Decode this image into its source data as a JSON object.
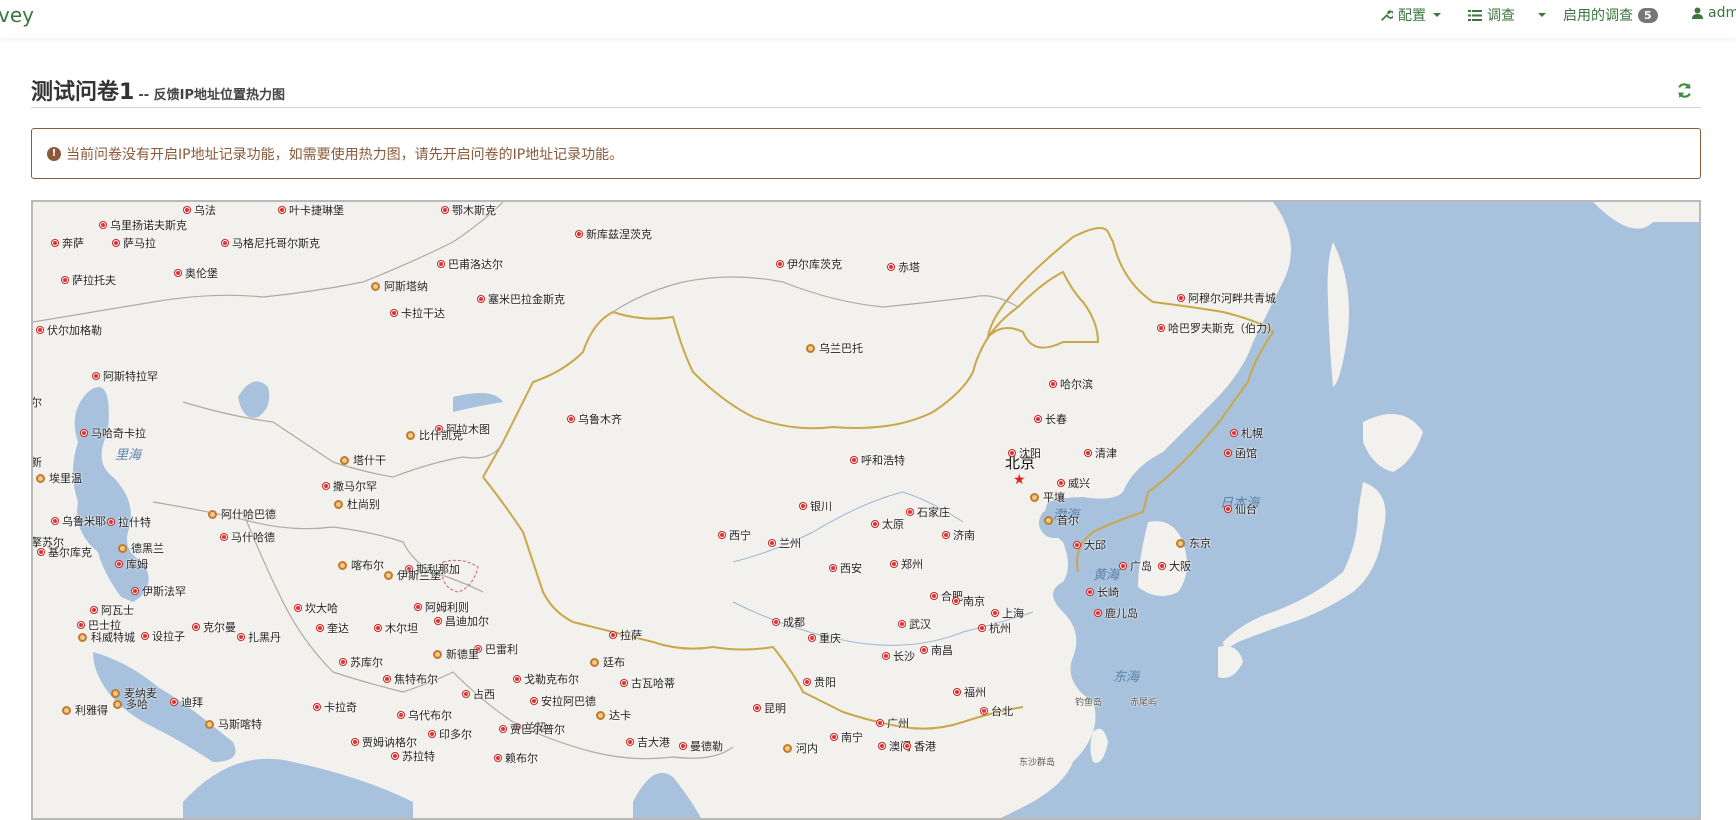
{
  "brand": "vey",
  "nav": {
    "config": "配置",
    "survey": "调查",
    "enabled_surveys": "启用的调查",
    "enabled_count": "5",
    "user": "admi"
  },
  "header": {
    "title": "测试问卷1",
    "subtitle": "-- 反馈IP地址位置热力图"
  },
  "alert": {
    "message": "当前问卷没有开启IP地址记录功能，如需要使用热力图，请先开启问卷的IP地址记录功能。"
  },
  "map": {
    "colors": {
      "land": "#f3f1ed",
      "water": "#a8c1dc",
      "border": "#c8a84a",
      "minor_border": "#b0aaa0"
    },
    "capital": "北京",
    "seas": [
      "里海",
      "渤海",
      "黄海",
      "东海",
      "日本海"
    ],
    "islands": [
      "钓鱼岛",
      "赤尾屿",
      "东沙群岛"
    ],
    "cities": [
      {
        "name": "乌法",
        "kind": "dot"
      },
      {
        "name": "叶卡捷琳堡",
        "kind": "dot"
      },
      {
        "name": "鄂木斯克",
        "kind": "dot"
      },
      {
        "name": "乌里扬诺夫斯克",
        "kind": "dot"
      },
      {
        "name": "奔萨",
        "kind": "dot"
      },
      {
        "name": "萨马拉",
        "kind": "dot"
      },
      {
        "name": "马格尼托哥尔斯克",
        "kind": "dot"
      },
      {
        "name": "新库兹涅茨克",
        "kind": "dot"
      },
      {
        "name": "巴甫洛达尔",
        "kind": "dot"
      },
      {
        "name": "奥伦堡",
        "kind": "dot"
      },
      {
        "name": "萨拉托夫",
        "kind": "dot"
      },
      {
        "name": "阿斯塔纳",
        "kind": "cap"
      },
      {
        "name": "塞米巴拉金斯克",
        "kind": "dot"
      },
      {
        "name": "伊尔库茨克",
        "kind": "dot"
      },
      {
        "name": "赤塔",
        "kind": "dot"
      },
      {
        "name": "阿穆尔河畔共青城",
        "kind": "dot"
      },
      {
        "name": "卡拉干达",
        "kind": "dot"
      },
      {
        "name": "伏尔加格勒",
        "kind": "dot"
      },
      {
        "name": "哈巴罗夫斯克（伯力）",
        "kind": "dot"
      },
      {
        "name": "乌兰巴托",
        "kind": "cap"
      },
      {
        "name": "阿斯特拉罕",
        "kind": "dot"
      },
      {
        "name": "哈尔滨",
        "kind": "dot"
      },
      {
        "name": "乌鲁木齐",
        "kind": "dot"
      },
      {
        "name": "长春",
        "kind": "dot"
      },
      {
        "name": "马哈奇卡拉",
        "kind": "dot"
      },
      {
        "name": "阿拉木图",
        "kind": "dot"
      },
      {
        "name": "比什凯克",
        "kind": "cap"
      },
      {
        "name": "札幌",
        "kind": "dot"
      },
      {
        "name": "沈阳",
        "kind": "dot"
      },
      {
        "name": "清津",
        "kind": "dot"
      },
      {
        "name": "函馆",
        "kind": "dot"
      },
      {
        "name": "呼和浩特",
        "kind": "dot"
      },
      {
        "name": "塔什干",
        "kind": "cap"
      },
      {
        "name": "埃里温",
        "kind": "cap"
      },
      {
        "name": "撒马尔罕",
        "kind": "dot"
      },
      {
        "name": "威兴",
        "kind": "dot"
      },
      {
        "name": "平壤",
        "kind": "cap"
      },
      {
        "name": "杜尚别",
        "kind": "cap"
      },
      {
        "name": "银川",
        "kind": "dot"
      },
      {
        "name": "石家庄",
        "kind": "dot"
      },
      {
        "name": "阿什哈巴德",
        "kind": "cap"
      },
      {
        "name": "仙台",
        "kind": "dot"
      },
      {
        "name": "乌鲁米耶",
        "kind": "dot"
      },
      {
        "name": "拉什特",
        "kind": "dot"
      },
      {
        "name": "太原",
        "kind": "dot"
      },
      {
        "name": "首尔",
        "kind": "cap"
      },
      {
        "name": "马什哈德",
        "kind": "dot"
      },
      {
        "name": "西宁",
        "kind": "dot"
      },
      {
        "name": "济南",
        "kind": "dot"
      },
      {
        "name": "兰州",
        "kind": "dot"
      },
      {
        "name": "大邱",
        "kind": "dot"
      },
      {
        "name": "东京",
        "kind": "cap"
      },
      {
        "name": "德黑兰",
        "kind": "cap"
      },
      {
        "name": "基尔库克",
        "kind": "dot"
      },
      {
        "name": "喀布尔",
        "kind": "cap"
      },
      {
        "name": "库姆",
        "kind": "dot"
      },
      {
        "name": "斯利那加",
        "kind": "dot"
      },
      {
        "name": "郑州",
        "kind": "dot"
      },
      {
        "name": "西安",
        "kind": "dot"
      },
      {
        "name": "广岛",
        "kind": "dot"
      },
      {
        "name": "大阪",
        "kind": "dot"
      },
      {
        "name": "伊斯兰堡",
        "kind": "cap"
      },
      {
        "name": "伊斯法罕",
        "kind": "dot"
      },
      {
        "name": "阿姆利则",
        "kind": "dot"
      },
      {
        "name": "合肥",
        "kind": "dot"
      },
      {
        "name": "南京",
        "kind": "dot"
      },
      {
        "name": "长崎",
        "kind": "dot"
      },
      {
        "name": "坎大哈",
        "kind": "dot"
      },
      {
        "name": "上海",
        "kind": "dot"
      },
      {
        "name": "阿瓦士",
        "kind": "dot"
      },
      {
        "name": "鹿儿岛",
        "kind": "dot"
      },
      {
        "name": "巴士拉",
        "kind": "dot"
      },
      {
        "name": "成都",
        "kind": "dot"
      },
      {
        "name": "昌迪加尔",
        "kind": "dot"
      },
      {
        "name": "武汉",
        "kind": "dot"
      },
      {
        "name": "克尔曼",
        "kind": "dot"
      },
      {
        "name": "杭州",
        "kind": "dot"
      },
      {
        "name": "科威特城",
        "kind": "cap"
      },
      {
        "name": "设拉子",
        "kind": "dot"
      },
      {
        "name": "奎达",
        "kind": "dot"
      },
      {
        "name": "木尔坦",
        "kind": "dot"
      },
      {
        "name": "扎黑丹",
        "kind": "dot"
      },
      {
        "name": "拉萨",
        "kind": "dot"
      },
      {
        "name": "重庆",
        "kind": "dot"
      },
      {
        "name": "巴雷利",
        "kind": "dot"
      },
      {
        "name": "南昌",
        "kind": "dot"
      },
      {
        "name": "长沙",
        "kind": "dot"
      },
      {
        "name": "新德里",
        "kind": "cap"
      },
      {
        "name": "苏库尔",
        "kind": "dot"
      },
      {
        "name": "廷布",
        "kind": "cap"
      },
      {
        "name": "焦特布尔",
        "kind": "dot"
      },
      {
        "name": "戈勒克布尔",
        "kind": "dot"
      },
      {
        "name": "贵阳",
        "kind": "dot"
      },
      {
        "name": "古瓦哈蒂",
        "kind": "dot"
      },
      {
        "name": "麦纳麦",
        "kind": "cap"
      },
      {
        "name": "福州",
        "kind": "dot"
      },
      {
        "name": "占西",
        "kind": "dot"
      },
      {
        "name": "安拉阿巴德",
        "kind": "dot"
      },
      {
        "name": "迪拜",
        "kind": "dot"
      },
      {
        "name": "多哈",
        "kind": "cap"
      },
      {
        "name": "卡拉奇",
        "kind": "dot"
      },
      {
        "name": "利雅得",
        "kind": "cap"
      },
      {
        "name": "乌代布尔",
        "kind": "dot"
      },
      {
        "name": "昆明",
        "kind": "dot"
      },
      {
        "name": "台北",
        "kind": "dot"
      },
      {
        "name": "达卡",
        "kind": "cap"
      },
      {
        "name": "马斯喀特",
        "kind": "cap"
      },
      {
        "name": "广州",
        "kind": "dot"
      },
      {
        "name": "兰契",
        "kind": "dot"
      },
      {
        "name": "贾巴尔普尔",
        "kind": "dot"
      },
      {
        "name": "南宁",
        "kind": "dot"
      },
      {
        "name": "印多尔",
        "kind": "dot"
      },
      {
        "name": "贾姆讷格尔",
        "kind": "dot"
      },
      {
        "name": "吉大港",
        "kind": "dot"
      },
      {
        "name": "澳门",
        "kind": "dot"
      },
      {
        "name": "香港",
        "kind": "dot"
      },
      {
        "name": "曼德勒",
        "kind": "dot"
      },
      {
        "name": "河内",
        "kind": "cap"
      },
      {
        "name": "苏拉特",
        "kind": "dot"
      },
      {
        "name": "赖布尔",
        "kind": "dot"
      },
      {
        "name": "尔",
        "kind": "text"
      },
      {
        "name": "新",
        "kind": "text"
      },
      {
        "name": "擎苏尔",
        "kind": "text"
      }
    ]
  }
}
